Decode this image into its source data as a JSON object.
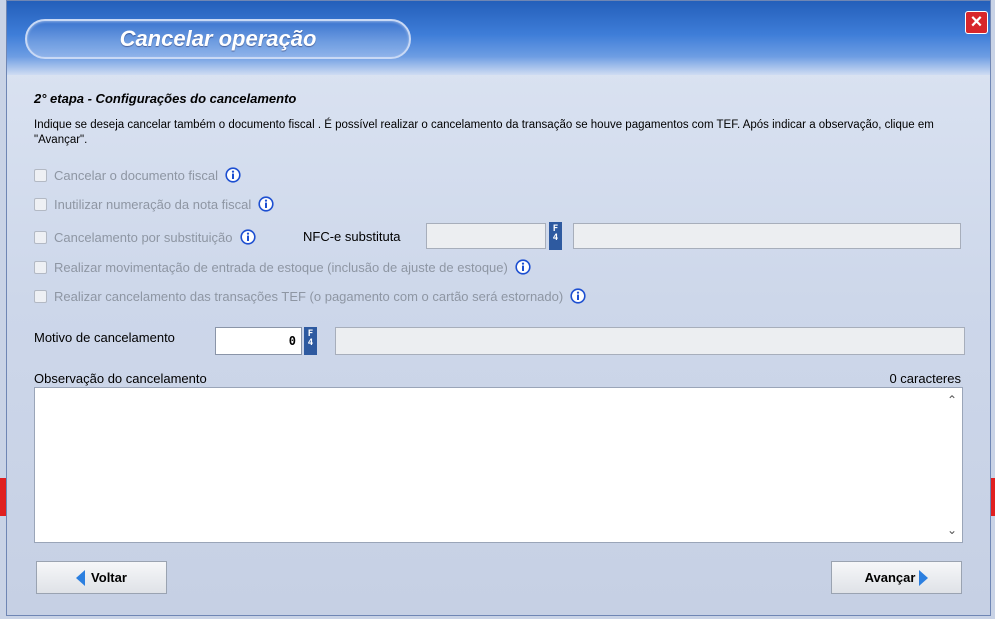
{
  "window": {
    "title": "Cancelar operação",
    "close_label": "×"
  },
  "step": {
    "title": "2° etapa - Configurações do cancelamento",
    "instructions": "Indique se deseja cancelar também o documento fiscal .  É possível realizar o cancelamento da transação se houve pagamentos com TEF.  Após indicar a observação, clique em \"Avançar\"."
  },
  "options": [
    {
      "label": "Cancelar o documento fiscal",
      "checked": false,
      "enabled": false
    },
    {
      "label": "Inutilizar numeração da nota fiscal",
      "checked": false,
      "enabled": false
    },
    {
      "label": "Cancelamento por substituição",
      "checked": false,
      "enabled": false
    },
    {
      "label": "Realizar movimentação de entrada de estoque (inclusão de ajuste de estoque)",
      "checked": false,
      "enabled": false
    },
    {
      "label": "Realizar cancelamento das transações TEF (o pagamento com o cartão será estornado)",
      "checked": false,
      "enabled": false
    }
  ],
  "nfce": {
    "label": "NFC-e substituta",
    "code": "",
    "description": ""
  },
  "motivo": {
    "label": "Motivo de cancelamento",
    "code": "0",
    "description": ""
  },
  "f4_key": "F4",
  "observacao": {
    "label": "Observação do cancelamento",
    "counter": "0 caracteres",
    "value": ""
  },
  "buttons": {
    "back": "Voltar",
    "next": "Avançar"
  },
  "colors": {
    "accent": "#2b7fe0",
    "close": "#d8262b",
    "title_bar": "#3e7dd8"
  }
}
